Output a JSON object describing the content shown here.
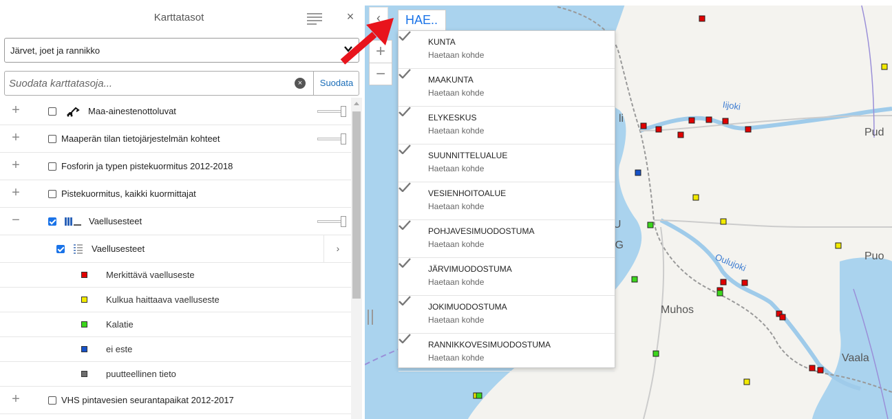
{
  "panel": {
    "title": "Karttatasot",
    "close_label": "×",
    "theme_select": "Järvet, joet ja rannikko",
    "filter": {
      "placeholder": "Suodata karttatasoja...",
      "value": "",
      "clear_label": "×",
      "button_label": "Suodata"
    },
    "layers": [
      {
        "label": "Maa-ainestenottoluvat",
        "checked": false,
        "expander": "+",
        "has_slider": true
      },
      {
        "label": "Maaperän tilan tietojärjestelmän kohteet",
        "checked": false,
        "expander": "+",
        "has_slider": true
      },
      {
        "label": "Fosforin ja typen pistekuormitus 2012-2018",
        "checked": false,
        "expander": "+",
        "has_slider": false
      },
      {
        "label": "Pistekuormitus, kaikki kuormittajat",
        "checked": false,
        "expander": "+",
        "has_slider": false
      },
      {
        "label": "Vaellusesteet",
        "checked": true,
        "expander": "−",
        "has_slider": true
      }
    ],
    "sublayer": {
      "label": "Vaellusesteet",
      "checked": true,
      "chevron": "›"
    },
    "legend": [
      {
        "label": "Merkittävä vaelluseste",
        "color": "#e00000"
      },
      {
        "label": "Kulkua haittaava vaelluseste",
        "color": "#f2ea00"
      },
      {
        "label": "Kalatie",
        "color": "#3cd61c"
      },
      {
        "label": "ei este",
        "color": "#1652c8"
      },
      {
        "label": "puutteellinen tieto",
        "color": "#6e6e6e"
      }
    ],
    "last_layer": {
      "label": "VHS pintavesien seurantapaikat 2012-2017",
      "checked": false,
      "expander": "+"
    }
  },
  "map": {
    "collapse_label": "‹",
    "zoom_in": "+",
    "zoom_out": "−",
    "search": {
      "tab_label": "HAE..",
      "results": [
        {
          "title": "KUNTA",
          "subtitle": "Haetaan kohde"
        },
        {
          "title": "MAAKUNTA",
          "subtitle": "Haetaan kohde"
        },
        {
          "title": "ELYKESKUS",
          "subtitle": "Haetaan kohde"
        },
        {
          "title": "SUUNNITTELUALUE",
          "subtitle": "Haetaan kohde"
        },
        {
          "title": "VESIENHOITOALUE",
          "subtitle": "Haetaan kohde"
        },
        {
          "title": "POHJAVESIMUODOSTUMA",
          "subtitle": "Haetaan kohde"
        },
        {
          "title": "JÄRVIMUODOSTUMA",
          "subtitle": "Haetaan kohde"
        },
        {
          "title": "JOKIMUODOSTUMA",
          "subtitle": "Haetaan kohde"
        },
        {
          "title": "RANNIKKOVESIMUODOSTUMA",
          "subtitle": "Haetaan kohde"
        }
      ]
    },
    "places": [
      "li",
      "LU",
      "RG",
      "Muhos",
      "Vaala",
      "Pud",
      "Puo"
    ],
    "rivers": [
      "Iijoki",
      "Oulujoki"
    ],
    "colors": {
      "sea": "#aad3ee",
      "land": "#f4f3ef",
      "river": "#9fcbea",
      "accent": "#1a73e8",
      "arrow": "#e8141c"
    }
  }
}
